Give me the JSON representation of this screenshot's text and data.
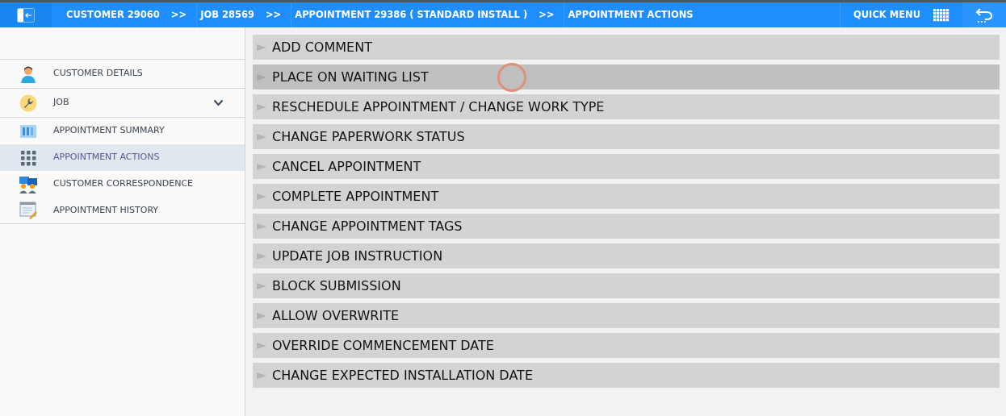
{
  "topbar": {
    "breadcrumbs": [
      {
        "label": "CUSTOMER 29060"
      },
      {
        "label": "JOB 28569"
      },
      {
        "label": "APPOINTMENT 29386 ( STANDARD INSTALL )"
      },
      {
        "label": "APPOINTMENT ACTIONS"
      }
    ],
    "separator": ">>",
    "quick_menu": "QUICK MENU"
  },
  "sidebar": {
    "items": [
      {
        "kind": "person",
        "label": "CUSTOMER DETAILS",
        "selected": false,
        "divider_after": true
      },
      {
        "kind": "wrench",
        "label": "JOB",
        "selected": false,
        "expanded": true,
        "divider_after": true
      },
      {
        "kind": "columns",
        "label": "APPOINTMENT SUMMARY",
        "selected": false,
        "divider_after": false
      },
      {
        "kind": "grid",
        "label": "APPOINTMENT ACTIONS",
        "selected": true,
        "divider_after": false
      },
      {
        "kind": "people",
        "label": "CUSTOMER CORRESPONDENCE",
        "selected": false,
        "divider_after": false
      },
      {
        "kind": "history",
        "label": "APPOINTMENT HISTORY",
        "selected": false,
        "divider_after": true
      }
    ]
  },
  "actions": [
    {
      "label": "ADD COMMENT",
      "hovered": false
    },
    {
      "label": "PLACE ON WAITING LIST",
      "hovered": true
    },
    {
      "label": "RESCHEDULE APPOINTMENT / CHANGE WORK TYPE",
      "hovered": false
    },
    {
      "label": "CHANGE PAPERWORK STATUS",
      "hovered": false
    },
    {
      "label": "CANCEL APPOINTMENT",
      "hovered": false
    },
    {
      "label": "COMPLETE APPOINTMENT",
      "hovered": false
    },
    {
      "label": "CHANGE APPOINTMENT TAGS",
      "hovered": false
    },
    {
      "label": "UPDATE JOB INSTRUCTION",
      "hovered": false
    },
    {
      "label": "BLOCK SUBMISSION",
      "hovered": false
    },
    {
      "label": "ALLOW OVERWRITE",
      "hovered": false
    },
    {
      "label": "OVERRIDE COMMENCEMENT DATE",
      "hovered": false
    },
    {
      "label": "CHANGE EXPECTED INSTALLATION DATE",
      "hovered": false
    }
  ]
}
